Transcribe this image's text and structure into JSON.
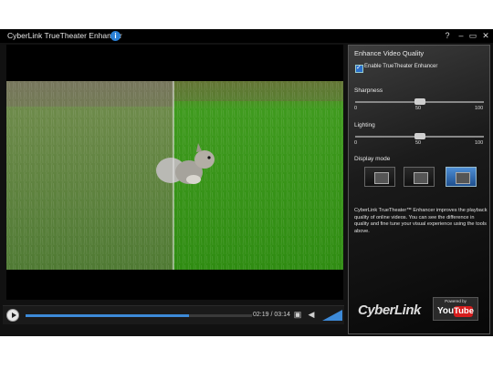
{
  "app": {
    "title": "CyberLink TrueTheater Enhancer",
    "help_icon_glyph": "?",
    "window_controls": [
      "?",
      "–",
      "▭",
      "✕"
    ]
  },
  "player": {
    "timecode": "02:19 / 03:14",
    "progress": 0.72,
    "icons": [
      "play-icon",
      "display-mode-icon",
      "volume-icon"
    ]
  },
  "panel": {
    "title": "Enhance Video Quality",
    "enable_label": "Enable TrueTheater Enhancer",
    "enable_checked": true,
    "sharpness": {
      "label": "Sharpness",
      "min": "0",
      "mid": "50",
      "max": "100",
      "value": 50
    },
    "lighting": {
      "label": "Lighting",
      "min": "0",
      "mid": "50",
      "max": "100",
      "value": 50
    },
    "display_mode": {
      "label": "Display mode",
      "modes": [
        "original",
        "split",
        "enhanced"
      ],
      "selected": "enhanced"
    },
    "description": "CyberLink TrueTheater™ Enhancer improves the playback quality of online videos. You can see the difference in quality and fine tune your visual experience using the tools above.",
    "brand": "CyberLink",
    "youtube": {
      "powered_by": "Powered by",
      "you": "You",
      "tube": "Tube"
    }
  },
  "colors": {
    "accent": "#3d8ad8",
    "youtube_red": "#d51c1c",
    "chrome": "#000000"
  }
}
